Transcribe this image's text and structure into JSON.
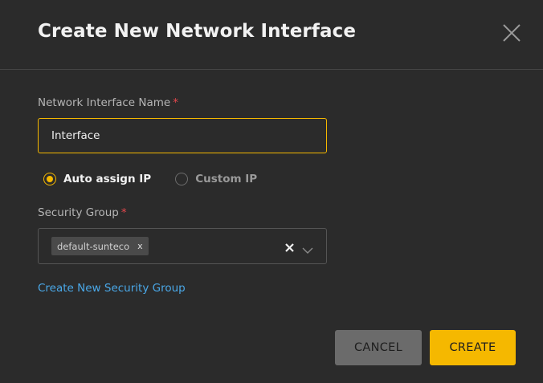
{
  "dialog": {
    "title": "Create New Network Interface",
    "close_icon": "close-icon"
  },
  "name_field": {
    "label": "Network Interface Name",
    "required_mark": "*",
    "value": "Interface"
  },
  "ip_mode": {
    "options": [
      {
        "label": "Auto assign IP",
        "selected": true
      },
      {
        "label": "Custom IP",
        "selected": false
      }
    ]
  },
  "security_group": {
    "label": "Security Group",
    "required_mark": "*",
    "selected_tags": [
      "default-sunteco"
    ],
    "tag_remove_glyph": "x",
    "clear_glyph": "X",
    "dropdown_icon": "chevron-down-icon"
  },
  "create_security_group_link": "Create New Security Group",
  "buttons": {
    "cancel": "CANCEL",
    "create": "CREATE"
  },
  "colors": {
    "background": "#2b2b2b",
    "accent": "#f5b800",
    "link": "#4aa8e8",
    "required": "#e5484d",
    "cancel_bg": "#6b6b6b"
  }
}
